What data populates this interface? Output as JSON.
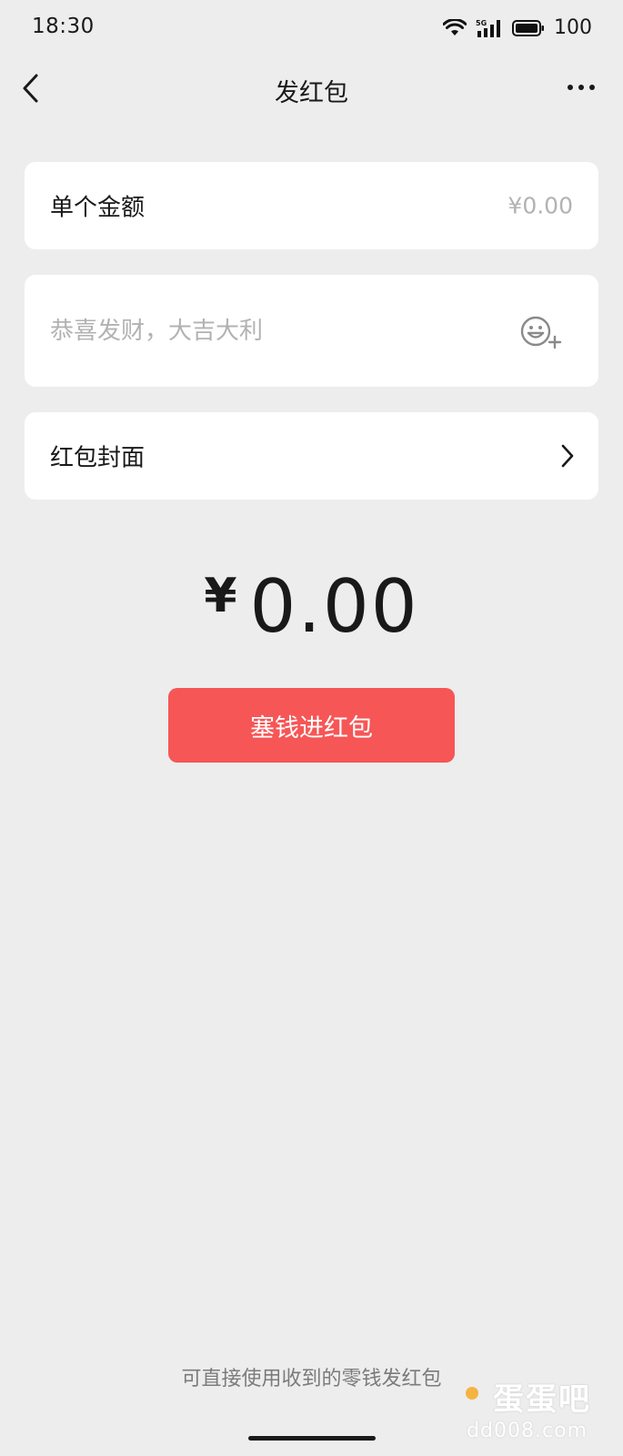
{
  "status_bar": {
    "time": "18:30",
    "network": "5G",
    "battery": "100"
  },
  "nav": {
    "title": "发红包",
    "back_icon": "chevron-left-icon",
    "more_icon": "more-dots-icon"
  },
  "amount_card": {
    "label": "单个金额",
    "value": "¥0.00"
  },
  "message_card": {
    "placeholder": "恭喜发财，大吉大利",
    "emoji_icon": "emoji-add-icon"
  },
  "cover_card": {
    "label": "红包封面",
    "chevron_icon": "chevron-right-icon"
  },
  "total": {
    "currency": "¥",
    "amount": "0.00"
  },
  "primary_button": {
    "label": "塞钱进红包",
    "color": "#f65656"
  },
  "footer": {
    "tip": "可直接使用收到的零钱发红包"
  },
  "watermark": {
    "top": "蛋蛋吧",
    "bottom": "dd008.com"
  }
}
